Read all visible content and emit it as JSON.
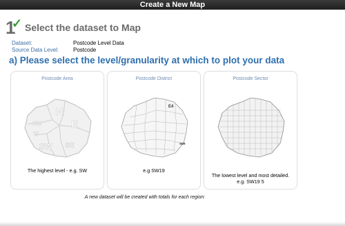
{
  "window": {
    "title": "Create a New Map"
  },
  "step": {
    "number": "1",
    "title": "Select the dataset to Map"
  },
  "meta": [
    {
      "key": "Dataset:",
      "value": "Postcode Level Data"
    },
    {
      "key": "Source Data Level:",
      "value": "Postcode"
    }
  ],
  "question": "a) Please select the level/granularity at which to plot your data",
  "cards": [
    {
      "title": "Postcode Area",
      "caption": "The highest level - e.g. SW",
      "labels": [
        "N",
        "NW",
        "E",
        "W",
        "SW",
        "SE"
      ]
    },
    {
      "title": "Postcode District",
      "caption": "e.g SW19",
      "labels": [
        "E4",
        "SE9"
      ]
    },
    {
      "title": "Postcode Sector",
      "caption": "The lowest level and most detailed. e.g. SW19 5",
      "labels": []
    }
  ],
  "footnote": "A new dataset will be created with totals for each region:",
  "colors": {
    "accent": "#2e6fae",
    "label": "#3a6ea5",
    "check": "#2f9a2f"
  }
}
